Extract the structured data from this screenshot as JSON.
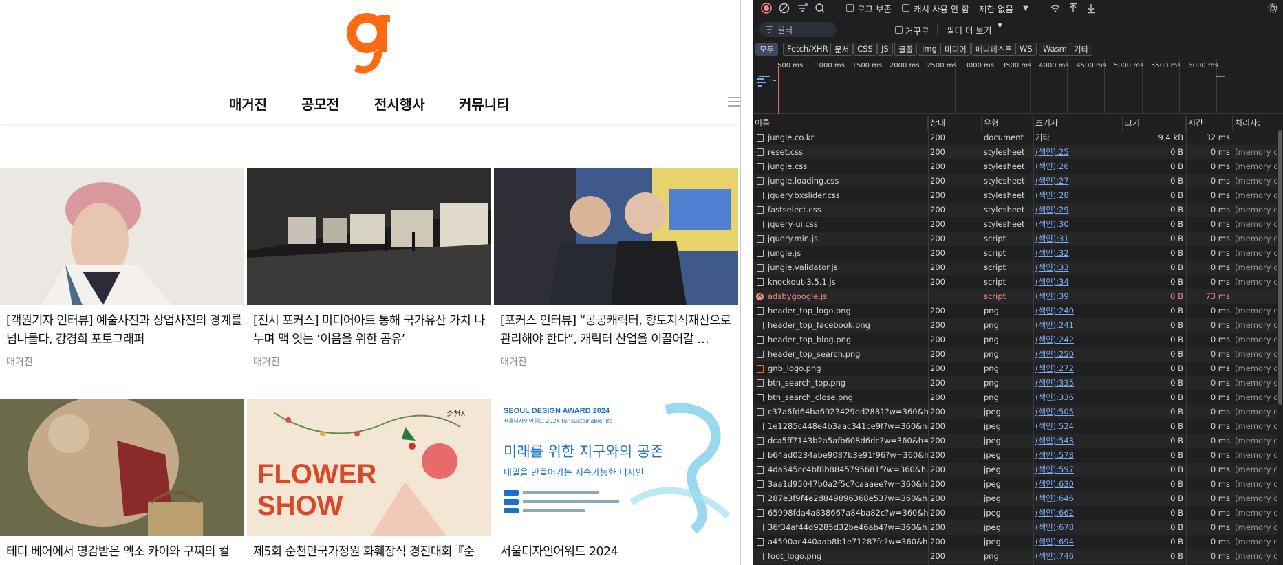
{
  "site": {
    "nav": [
      "매거진",
      "공모전",
      "전시행사",
      "커뮤니티"
    ],
    "cards": [
      {
        "title": "[객원기자 인터뷰] 예술사진과 상업사진의 경계를 넘나들다, 강경희 포토그래퍼",
        "category": "매거진"
      },
      {
        "title": "[전시 포커스] 미디어아트 통해 국가유산 가치 나누며 맥 잇는 ‘이음을 위한 공유’",
        "category": "매거진"
      },
      {
        "title": "[포커스 인터뷰] “공공캐릭터, 향토지식재산으로 관리해야 한다”, 캐릭터 산업을 이끌어갈 …",
        "category": "매거진"
      },
      {
        "title": "테디 베어에서 영감받은 엑소 카이와 구찌의 컬",
        "category": ""
      },
      {
        "title": "제5회 순천만국가정원 화훼장식 경진대회『순",
        "category": ""
      },
      {
        "title": "서울디자인어워드 2024",
        "category": ""
      }
    ],
    "flower_show": {
      "line1": "FLOWER",
      "line2": "SHOW",
      "badge": "순천시"
    },
    "sda": {
      "header": "SEOUL DESIGN AWARD 2024",
      "sub": "서울디자인어워드 2024 for sustainable life",
      "main": "미래를 위한 지구와의 공존",
      "tagline": "내일을 만들어가는 지속가능한 디자인"
    }
  },
  "devtools": {
    "toolbar": {
      "preserve_log": "로그 보존",
      "disable_cache": "캐시 사용 안 함",
      "throttle": "제한 없음"
    },
    "filter": {
      "placeholder": "필터",
      "invert": "거꾸로",
      "more": "필터 더 보기"
    },
    "chips": [
      "모두",
      "Fetch/XHR",
      "문서",
      "CSS",
      "JS",
      "글꼴",
      "Img",
      "미디어",
      "매니페스트",
      "WS",
      "Wasm",
      "기타"
    ],
    "timeline_ticks": [
      "500 ms",
      "1000 ms",
      "1500 ms",
      "2000 ms",
      "2500 ms",
      "3000 ms",
      "3500 ms",
      "4000 ms",
      "4500 ms",
      "5000 ms",
      "5500 ms",
      "6000 ms"
    ],
    "columns": [
      "이름",
      "상태",
      "유형",
      "초기자",
      "크기",
      "시간",
      "처리자:"
    ],
    "rows": [
      {
        "name": "jungle.co.kr",
        "status": "200",
        "type": "document",
        "initiator": "기타",
        "size": "9.4 kB",
        "time": "32 ms",
        "proc": ""
      },
      {
        "name": "reset.css",
        "status": "200",
        "type": "stylesheet",
        "initiator": "(색인):25",
        "size": "0 B",
        "time": "0 ms",
        "proc": "(memory c..."
      },
      {
        "name": "jungle.css",
        "status": "200",
        "type": "stylesheet",
        "initiator": "(색인):26",
        "size": "0 B",
        "time": "0 ms",
        "proc": "(memory c..."
      },
      {
        "name": "jungle.loading.css",
        "status": "200",
        "type": "stylesheet",
        "initiator": "(색인):27",
        "size": "0 B",
        "time": "0 ms",
        "proc": "(memory c..."
      },
      {
        "name": "jquery.bxslider.css",
        "status": "200",
        "type": "stylesheet",
        "initiator": "(색인):28",
        "size": "0 B",
        "time": "0 ms",
        "proc": "(memory c..."
      },
      {
        "name": "fastselect.css",
        "status": "200",
        "type": "stylesheet",
        "initiator": "(색인):29",
        "size": "0 B",
        "time": "0 ms",
        "proc": "(memory c..."
      },
      {
        "name": "jquery-ui.css",
        "status": "200",
        "type": "stylesheet",
        "initiator": "(색인):30",
        "size": "0 B",
        "time": "0 ms",
        "proc": "(memory c..."
      },
      {
        "name": "jquery.min.js",
        "status": "200",
        "type": "script",
        "initiator": "(색인):31",
        "size": "0 B",
        "time": "0 ms",
        "proc": "(memory c..."
      },
      {
        "name": "jungle.js",
        "status": "200",
        "type": "script",
        "initiator": "(색인):32",
        "size": "0 B",
        "time": "0 ms",
        "proc": "(memory c..."
      },
      {
        "name": "jungle.validator.js",
        "status": "200",
        "type": "script",
        "initiator": "(색인):33",
        "size": "0 B",
        "time": "0 ms",
        "proc": "(memory c..."
      },
      {
        "name": "knockout-3.5.1.js",
        "status": "200",
        "type": "script",
        "initiator": "(색인):34",
        "size": "0 B",
        "time": "0 ms",
        "proc": "(memory c..."
      },
      {
        "name": "adsbygoogle.js",
        "status": "",
        "type": "script",
        "initiator": "(색인):39",
        "size": "0 B",
        "time": "73 ms",
        "proc": "",
        "error": true
      },
      {
        "name": "header_top_logo.png",
        "status": "200",
        "type": "png",
        "initiator": "(색인):240",
        "size": "0 B",
        "time": "0 ms",
        "proc": "(memory c..."
      },
      {
        "name": "header_top_facebook.png",
        "status": "200",
        "type": "png",
        "initiator": "(색인):241",
        "size": "0 B",
        "time": "0 ms",
        "proc": "(memory c..."
      },
      {
        "name": "header_top_blog.png",
        "status": "200",
        "type": "png",
        "initiator": "(색인):242",
        "size": "0 B",
        "time": "0 ms",
        "proc": "(memory c..."
      },
      {
        "name": "header_top_search.png",
        "status": "200",
        "type": "png",
        "initiator": "(색인):250",
        "size": "0 B",
        "time": "0 ms",
        "proc": "(memory c..."
      },
      {
        "name": "gnb_logo.png",
        "status": "200",
        "type": "png",
        "initiator": "(색인):272",
        "size": "0 B",
        "time": "0 ms",
        "proc": "(memory c..."
      },
      {
        "name": "btn_search_top.png",
        "status": "200",
        "type": "png",
        "initiator": "(색인):335",
        "size": "0 B",
        "time": "0 ms",
        "proc": "(memory c..."
      },
      {
        "name": "btn_search_close.png",
        "status": "200",
        "type": "png",
        "initiator": "(색인):336",
        "size": "0 B",
        "time": "0 ms",
        "proc": "(memory c..."
      },
      {
        "name": "c37a6fd64ba6923429ed2881?w=360&h...",
        "status": "200",
        "type": "jpeg",
        "initiator": "(색인):505",
        "size": "0 B",
        "time": "0 ms",
        "proc": "(memory c..."
      },
      {
        "name": "1e1285c448e4b3aac341ce9f?w=360&h=...",
        "status": "200",
        "type": "jpeg",
        "initiator": "(색인):524",
        "size": "0 B",
        "time": "0 ms",
        "proc": "(memory c..."
      },
      {
        "name": "dca5ff7143b2a5afb608d6dc?w=360&h=...",
        "status": "200",
        "type": "jpeg",
        "initiator": "(색인):543",
        "size": "0 B",
        "time": "0 ms",
        "proc": "(memory c..."
      },
      {
        "name": "b64ad0234abe9087b3e91f96?w=360&h...",
        "status": "200",
        "type": "jpeg",
        "initiator": "(색인):578",
        "size": "0 B",
        "time": "0 ms",
        "proc": "(memory c..."
      },
      {
        "name": "4da545cc4bf8b8845795681f?w=360&h...",
        "status": "200",
        "type": "jpeg",
        "initiator": "(색인):597",
        "size": "0 B",
        "time": "0 ms",
        "proc": "(memory c..."
      },
      {
        "name": "3aa1d95047b0a2f5c7caaaee?w=360&h=...",
        "status": "200",
        "type": "jpeg",
        "initiator": "(색인):630",
        "size": "0 B",
        "time": "0 ms",
        "proc": "(memory c..."
      },
      {
        "name": "287e3f9f4e2d849896368e53?w=360&h...",
        "status": "200",
        "type": "jpeg",
        "initiator": "(색인):646",
        "size": "0 B",
        "time": "0 ms",
        "proc": "(memory c..."
      },
      {
        "name": "65998fda4a838667a84ba82c?w=360&h...",
        "status": "200",
        "type": "jpeg",
        "initiator": "(색인):662",
        "size": "0 B",
        "time": "0 ms",
        "proc": "(memory c..."
      },
      {
        "name": "36f34af44d9285d32be46ab4?w=360&h...",
        "status": "200",
        "type": "jpeg",
        "initiator": "(색인):678",
        "size": "0 B",
        "time": "0 ms",
        "proc": "(memory c..."
      },
      {
        "name": "a4590ac440aab8b1e71287fc?w=360&h=...",
        "status": "200",
        "type": "jpeg",
        "initiator": "(색인):694",
        "size": "0 B",
        "time": "0 ms",
        "proc": "(memory c..."
      },
      {
        "name": "foot_logo.png",
        "status": "200",
        "type": "png",
        "initiator": "(색인):746",
        "size": "0 B",
        "time": "0 ms",
        "proc": "(memory c..."
      }
    ]
  },
  "colors": {
    "logo": "#ff6a13",
    "devtools_bg": "#1f1f1f",
    "link": "#7cacf8",
    "error": "#f28b82",
    "record": "#f28b82"
  }
}
